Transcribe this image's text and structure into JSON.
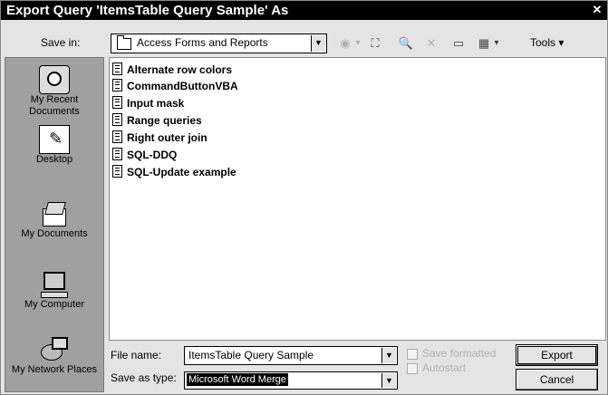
{
  "dialog": {
    "title": "Export Query 'ItemsTable Query Sample' As",
    "close_glyph": "✕"
  },
  "savein": {
    "label": "Save in:",
    "value": "Access Forms and Reports"
  },
  "toolbar": {
    "back_glyph": "◉",
    "back_arrow": "▾",
    "up_glyph": "⛶",
    "search_glyph": "🔍",
    "delete_glyph": "✕",
    "newfolder_glyph": "▭",
    "views_glyph": "▦",
    "views_arrow": "▾",
    "tools_label": "Tools ▾"
  },
  "places": [
    {
      "label": "My Recent Documents",
      "icon": "recent-documents-icon"
    },
    {
      "label": "Desktop",
      "icon": "desktop-icon"
    },
    {
      "label": "My Documents",
      "icon": "my-documents-icon"
    },
    {
      "label": "My Computer",
      "icon": "my-computer-icon"
    },
    {
      "label": "My Network Places",
      "icon": "network-places-icon"
    }
  ],
  "files": [
    "Alternate row colors",
    "CommandButtonVBA",
    "Input mask",
    "Range queries",
    "Right outer join",
    "SQL-DDQ",
    "SQL-Update example"
  ],
  "footer": {
    "filename_label": "File name:",
    "filename_value": "ItemsTable Query Sample",
    "savetype_label": "Save as type:",
    "savetype_value": "Microsoft Word Merge",
    "save_formatted": "Save formatted",
    "autostart": "Autostart",
    "export_button": "Export",
    "cancel_button": "Cancel"
  }
}
